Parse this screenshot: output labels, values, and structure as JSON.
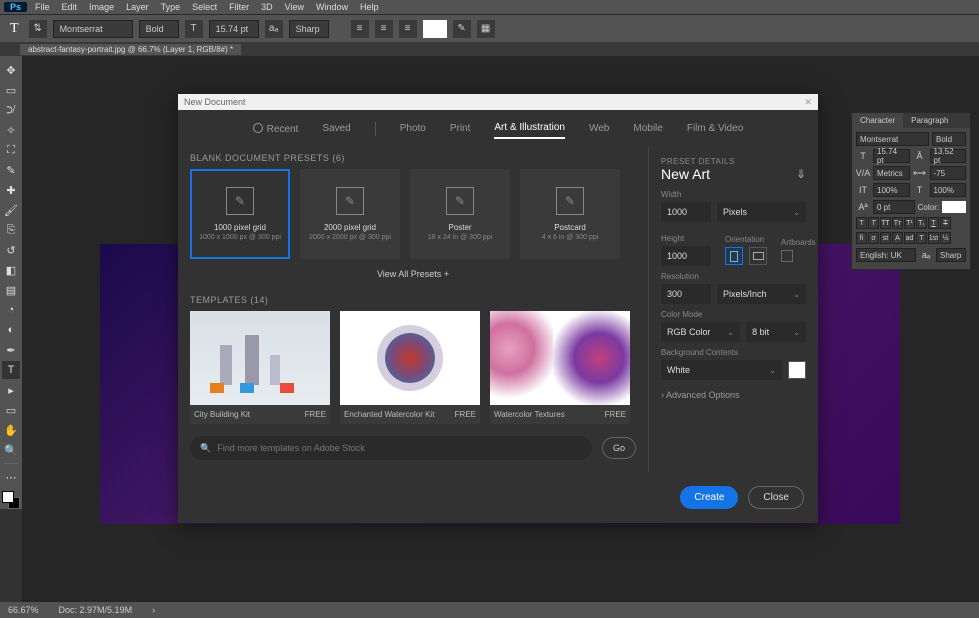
{
  "menu": [
    "File",
    "Edit",
    "Image",
    "Layer",
    "Type",
    "Select",
    "Filter",
    "3D",
    "View",
    "Window",
    "Help"
  ],
  "options_bar": {
    "font_family": "Montserrat",
    "font_style": "Bold",
    "font_size": "15.74 pt",
    "aa": "Sharp"
  },
  "document_tab": "abstract-fantasy-portrait.jpg @ 66.7% (Layer 1, RGB/8#) *",
  "status": {
    "zoom": "66.67%",
    "doc": "Doc: 2.97M/5.19M"
  },
  "char_panel": {
    "tabs": [
      "Character",
      "Paragraph"
    ],
    "font": "Montserrat",
    "style": "Bold",
    "size": "15.74 pt",
    "leading": "13.52 pt",
    "va": "Metrics",
    "tracking": "-75",
    "vert_scale": "100%",
    "horiz_scale": "100%",
    "baseline": "0 pt",
    "color_label": "Color:",
    "lang": "English: UK",
    "aa": "Sharp"
  },
  "dialog": {
    "title": "New Document",
    "tabs": [
      "Recent",
      "Saved",
      "Photo",
      "Print",
      "Art & Illustration",
      "Web",
      "Mobile",
      "Film & Video"
    ],
    "active_tab": "Art & Illustration",
    "blank_presets_header": "BLANK DOCUMENT PRESETS  (6)",
    "presets": [
      {
        "title": "1000 pixel grid",
        "sub": "1000 x 1000 px @ 300 ppi"
      },
      {
        "title": "2000 pixel grid",
        "sub": "2000 x 2000 px @ 300 ppi"
      },
      {
        "title": "Poster",
        "sub": "18 x 24 in @ 300 ppi"
      },
      {
        "title": "Postcard",
        "sub": "4 x 6 in @ 300 ppi"
      }
    ],
    "view_all": "View All Presets  +",
    "templates_header": "TEMPLATES  (14)",
    "templates": [
      {
        "title": "City Building Kit",
        "price": "FREE"
      },
      {
        "title": "Enchanted Watercolor Kit",
        "price": "FREE"
      },
      {
        "title": "Watercolor Textures",
        "price": "FREE"
      }
    ],
    "search_placeholder": "Find more templates on Adobe Stock",
    "go": "Go",
    "details": {
      "header": "PRESET DETAILS",
      "name": "New Art",
      "width_label": "Width",
      "width": "1000",
      "units": "Pixels",
      "height_label": "Height",
      "height": "1000",
      "orientation_label": "Orientation",
      "artboards_label": "Artboards",
      "resolution_label": "Resolution",
      "resolution": "300",
      "res_units": "Pixels/Inch",
      "color_mode_label": "Color Mode",
      "color_mode": "RGB Color",
      "bit_depth": "8 bit",
      "bg_label": "Background Contents",
      "bg": "White",
      "advanced": "Advanced Options"
    },
    "create": "Create",
    "close": "Close"
  }
}
